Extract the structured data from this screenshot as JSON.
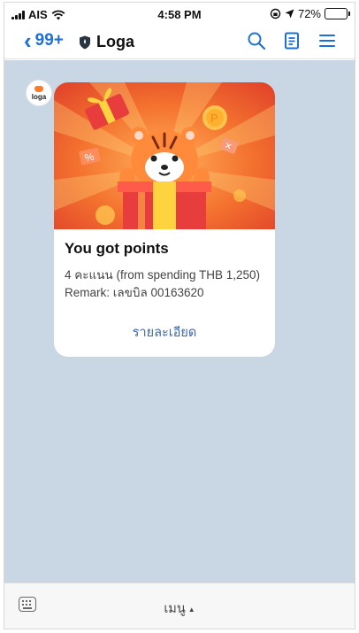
{
  "status_bar": {
    "carrier": "AIS",
    "time": "4:58 PM",
    "battery": "72%",
    "battery_level": 0.72
  },
  "nav": {
    "back_count": "99+",
    "title": "Loga",
    "icons": [
      "search-icon",
      "notes-icon",
      "menu-icon"
    ]
  },
  "chat": {
    "avatar_text": "loga",
    "card": {
      "title": "You got points",
      "line1": "4 คะแนน (from spending THB 1,250)",
      "line2": "Remark: เลขบิล 00163620",
      "link": "รายละเอียด"
    }
  },
  "bottom_bar": {
    "menu_label": "เมนู",
    "menu_arrow": "▲"
  },
  "colors": {
    "accent": "#1d70d9",
    "chat_bg": "#c9d6e3",
    "banner_orange": "#f26a2e",
    "link": "#3a67a6"
  }
}
